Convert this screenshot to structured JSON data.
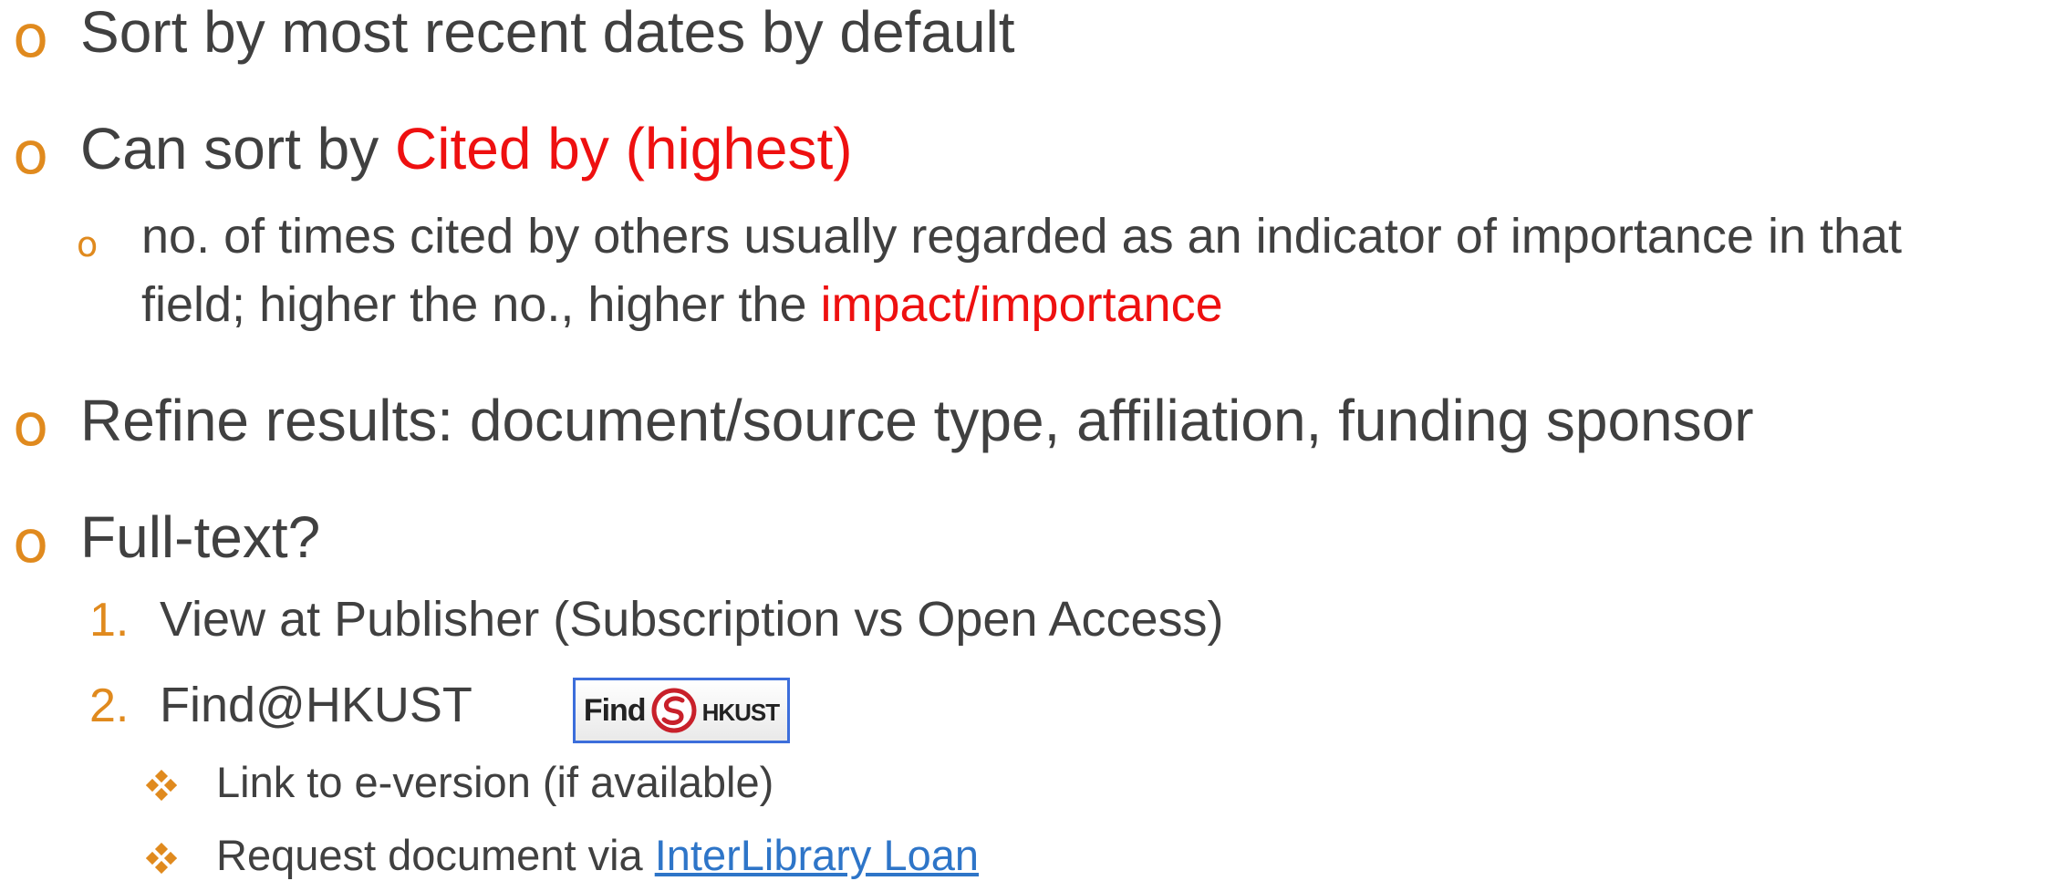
{
  "bullets": {
    "sort_default": "Sort by most recent dates by default",
    "can_sort": {
      "prefix": "Can sort by ",
      "highlight": "Cited by (highest)"
    },
    "cited_note": {
      "line1": "no. of times cited by others usually regarded as an indicator of importance in that",
      "line2_prefix": "field; higher the no., higher the ",
      "line2_highlight": "impact/importance"
    },
    "refine": "Refine results: document/source type, affiliation, funding sponsor",
    "fulltext": "Full-text?"
  },
  "fulltext_steps": [
    {
      "number": "1.",
      "label": "View at Publisher (Subscription vs Open Access)"
    },
    {
      "number": "2.",
      "label": "Find@HKUST"
    }
  ],
  "find_button": {
    "find": "Find",
    "brand": "HKUST",
    "icon": "hkust-logo-icon"
  },
  "sub_items": {
    "link_eversion": "Link to e-version (if available)",
    "request_prefix": "Request document via ",
    "request_link": "InterLibrary Loan"
  },
  "colors": {
    "text": "#404040",
    "accent": "#E08A1E",
    "highlight": "#EE1010",
    "link": "#2E75C8",
    "button_border": "#3C6EDB"
  }
}
